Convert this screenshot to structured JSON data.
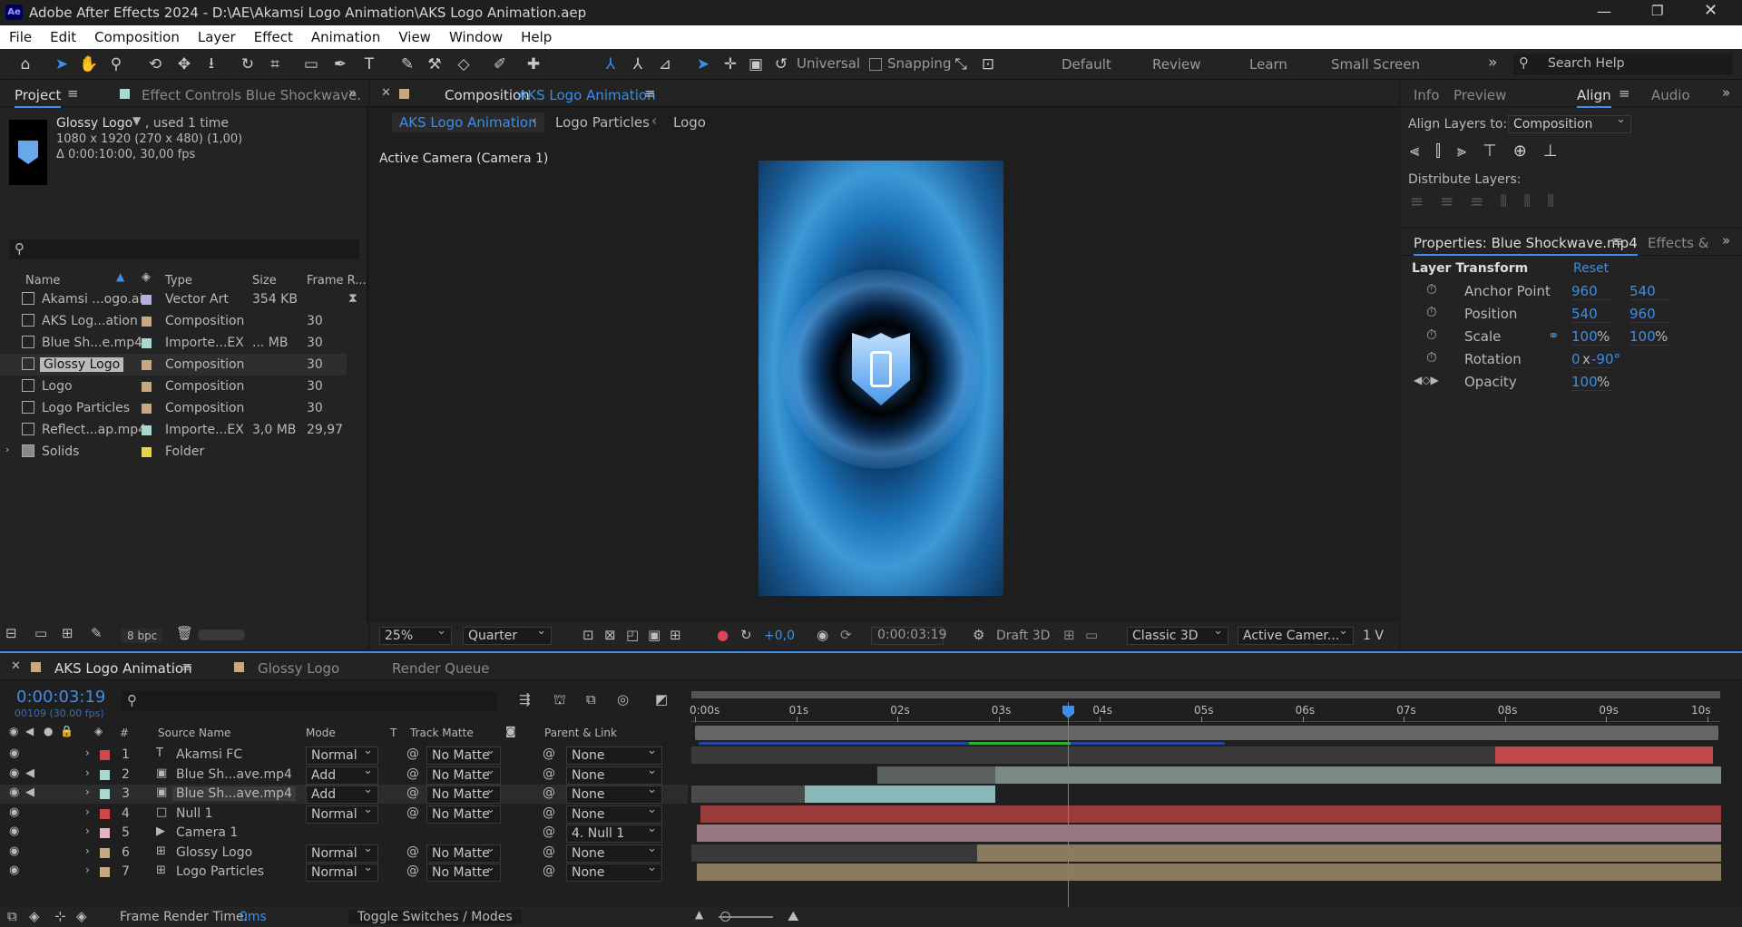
{
  "title": "Adobe After Effects 2024 - D:\\AE\\Akamsi Logo Animation\\AKS Logo Animation.aep",
  "menu": [
    "File",
    "Edit",
    "Composition",
    "Layer",
    "Effect",
    "Animation",
    "View",
    "Window",
    "Help"
  ],
  "toolbar": {
    "universal": "Universal",
    "snapping": "Snapping",
    "workspaces": [
      "Default",
      "Review",
      "Learn",
      "Small Screen"
    ],
    "search_placeholder": "Search Help"
  },
  "project": {
    "tab": "Project",
    "effect_tab": "Effect Controls Blue Shockwave.",
    "selected_name": "Glossy Logo",
    "used": ", used 1 time",
    "dims": "1080 x 1920  (270 x 480) (1,00)",
    "duration": "Δ 0:00:10:00, 30,00 fps",
    "columns": [
      "Name",
      "Type",
      "Size",
      "Frame R..."
    ],
    "items": [
      {
        "name": "Akamsi ...ogo.ai",
        "type": "Vector Art",
        "size": "354 KB",
        "rate": "",
        "color": "#b4b0e0"
      },
      {
        "name": "AKS Log...ation",
        "type": "Composition",
        "size": "",
        "rate": "30",
        "color": "#c8a882"
      },
      {
        "name": "Blue Sh...e.mp4",
        "type": "Importe...EX",
        "size": "... MB",
        "rate": "30",
        "color": "#a8d8d0"
      },
      {
        "name": "Glossy Logo",
        "type": "Composition",
        "size": "",
        "rate": "30",
        "color": "#c8a882"
      },
      {
        "name": "Logo",
        "type": "Composition",
        "size": "",
        "rate": "30",
        "color": "#c8a882"
      },
      {
        "name": "Logo Particles",
        "type": "Composition",
        "size": "",
        "rate": "30",
        "color": "#c8a882"
      },
      {
        "name": "Reflect...ap.mp4",
        "type": "Importe...EX",
        "size": "3,0 MB",
        "rate": "29,97",
        "color": "#a8d8d0"
      },
      {
        "name": "Solids",
        "type": "Folder",
        "size": "",
        "rate": "",
        "color": "#e8d44a"
      }
    ],
    "bpc": "8 bpc"
  },
  "comp": {
    "tab_prefix": "Composition",
    "tab_name": "AKS Logo Animation",
    "breadcrumbs": [
      "AKS Logo Animation",
      "Logo Particles",
      "Logo"
    ],
    "camera_label": "Active Camera (Camera 1)",
    "zoom": "25%",
    "resolution": "Quarter",
    "exposure": "+0,0",
    "timecode": "0:00:03:19",
    "draft": "Draft 3D",
    "renderer": "Classic 3D",
    "view": "Active Camer...",
    "views": "1 V"
  },
  "align": {
    "tabs": [
      "Info",
      "Preview",
      "Align",
      "Audio"
    ],
    "align_to_label": "Align Layers to:",
    "align_to": "Composition",
    "distribute": "Distribute Layers:"
  },
  "properties": {
    "title": "Properties: Blue Shockwave.mp4",
    "effects_tab": "Effects &",
    "section": "Layer Transform",
    "reset": "Reset",
    "rows": [
      {
        "label": "Anchor Point",
        "v1": "960",
        "v2": "540"
      },
      {
        "label": "Position",
        "v1": "540",
        "v2": "960"
      },
      {
        "label": "Scale",
        "v1": "100",
        "v2": "100"
      },
      {
        "label": "Rotation",
        "v1": "0",
        "v2": "-90°"
      },
      {
        "label": "Opacity",
        "v1": "100",
        "v2": ""
      }
    ],
    "pct": "%",
    "rot_x": "x"
  },
  "timeline": {
    "tabs": [
      "AKS Logo Animation",
      "Glossy Logo",
      "Render Queue"
    ],
    "timecode": "0:00:03:19",
    "frame": "00109 (30.00 fps)",
    "cols": [
      "#",
      "Source Name",
      "Mode",
      "T",
      "Track Matte",
      "Parent & Link"
    ],
    "ruler": [
      "0:00s",
      "01s",
      "02s",
      "03s",
      "04s",
      "05s",
      "06s",
      "07s",
      "08s",
      "09s",
      "10s"
    ],
    "layers": [
      {
        "n": "1",
        "name": "Akamsi FC",
        "mode": "Normal",
        "matte": "No Matte",
        "parent": "None",
        "color": "#d04848",
        "kind": "T"
      },
      {
        "n": "2",
        "name": "Blue Sh...ave.mp4",
        "mode": "Add",
        "matte": "No Matte",
        "parent": "None",
        "color": "#a8d8d0",
        "kind": "film"
      },
      {
        "n": "3",
        "name": "Blue Sh...ave.mp4",
        "mode": "Add",
        "matte": "No Matte",
        "parent": "None",
        "color": "#a8d8d0",
        "kind": "film"
      },
      {
        "n": "4",
        "name": "Null 1",
        "mode": "Normal",
        "matte": "No Matte",
        "parent": "None",
        "color": "#d04848",
        "kind": "null"
      },
      {
        "n": "5",
        "name": "Camera 1",
        "mode": "",
        "matte": "",
        "parent": "4. Null 1",
        "color": "#e4b4c0",
        "kind": "cam"
      },
      {
        "n": "6",
        "name": "Glossy Logo",
        "mode": "Normal",
        "matte": "No Matte",
        "parent": "None",
        "color": "#c8a882",
        "kind": "comp"
      },
      {
        "n": "7",
        "name": "Logo Particles",
        "mode": "Normal",
        "matte": "No Matte",
        "parent": "None",
        "color": "#c8a882",
        "kind": "comp"
      }
    ],
    "footer_label": "Frame Render Time:",
    "footer_value": "0ms",
    "toggle": "Toggle Switches / Modes"
  }
}
